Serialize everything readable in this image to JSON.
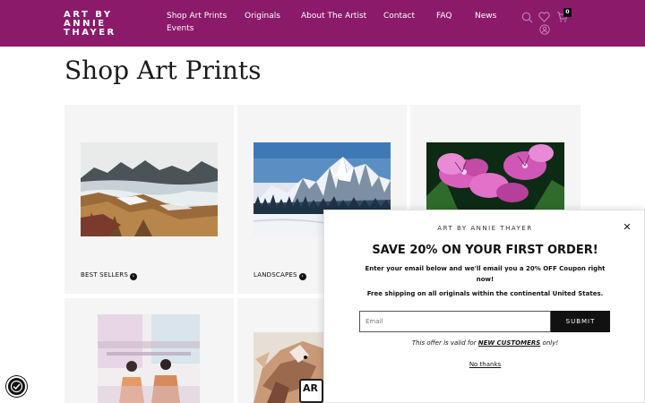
{
  "header": {
    "logo_line1": "ART BY",
    "logo_line2": "ANNIE",
    "logo_line3": "THAYER",
    "nav": [
      "Shop Art Prints",
      "Originals",
      "About The Artist",
      "Contact",
      "FAQ",
      "News",
      "Events"
    ],
    "cart_count": "0",
    "icons": [
      "search-icon",
      "wishlist-heart-icon",
      "account-icon",
      "cart-icon"
    ],
    "bg_color": "#8b1a6b"
  },
  "main": {
    "title": "Shop Art Prints",
    "categories": [
      {
        "label": "BEST SELLERS"
      },
      {
        "label": "LANDSCAPES"
      },
      {
        "label": ""
      },
      {
        "label": ""
      },
      {
        "label": ""
      }
    ]
  },
  "popup": {
    "brand": "ART BY ANNIE THAYER",
    "headline": "SAVE 20% ON YOUR FIRST ORDER!",
    "subtext": "Enter your email below and we'll email you a 20% OFF Coupon right now!",
    "shipping": "Free shipping on all originals within the continental United States.",
    "email_placeholder": "Email",
    "submit_label": "SUBMIT",
    "offer_prefix": "This offer is valid for ",
    "offer_bold": "NEW CUSTOMERS",
    "offer_suffix": " only!",
    "no_thanks": "No thanks"
  },
  "badge_text": "AR",
  "accessibility_icon": "accessibility-icon"
}
